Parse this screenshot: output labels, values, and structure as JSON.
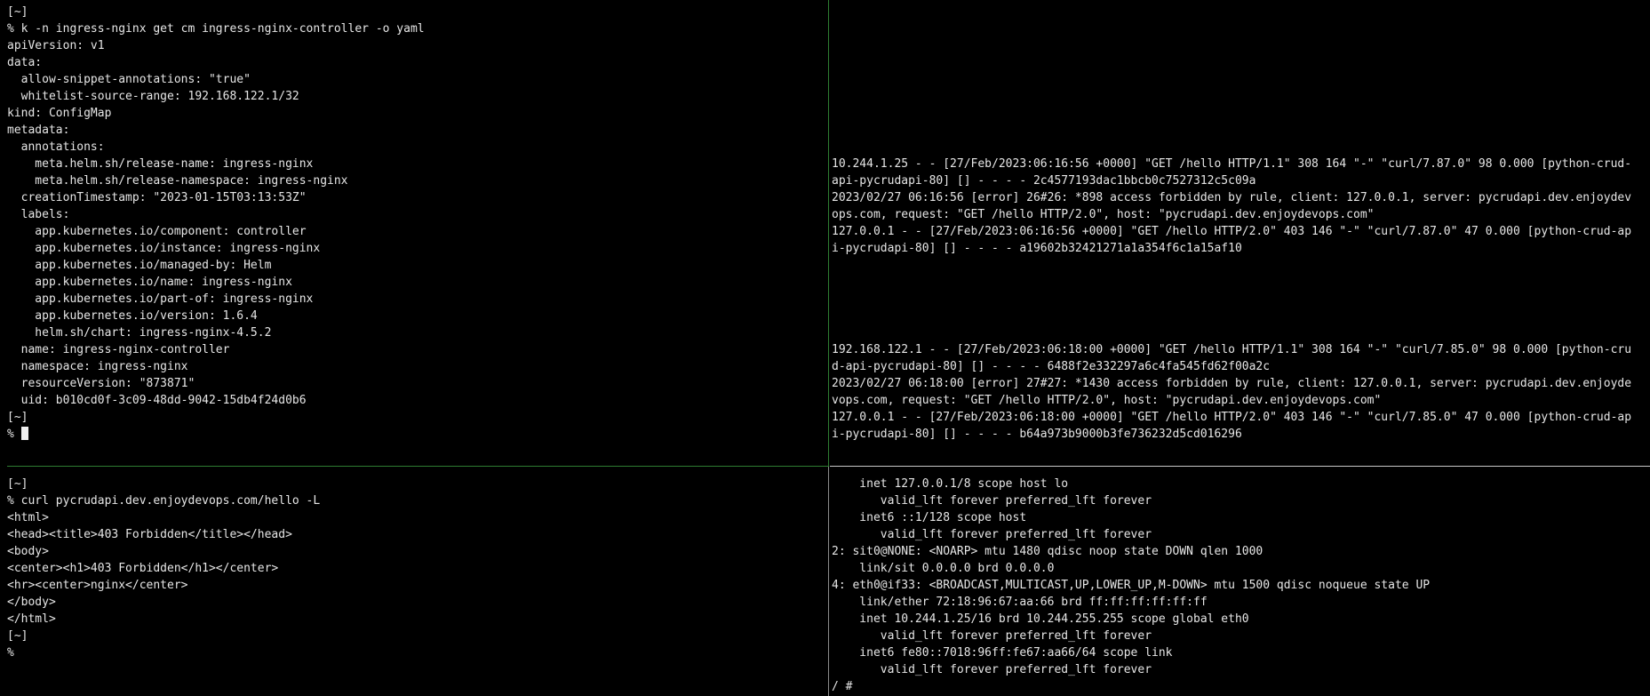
{
  "top_left": {
    "lines": [
      "[~]",
      "% k -n ingress-nginx get cm ingress-nginx-controller -o yaml",
      "apiVersion: v1",
      "data:",
      "  allow-snippet-annotations: \"true\"",
      "  whitelist-source-range: 192.168.122.1/32",
      "kind: ConfigMap",
      "metadata:",
      "  annotations:",
      "    meta.helm.sh/release-name: ingress-nginx",
      "    meta.helm.sh/release-namespace: ingress-nginx",
      "  creationTimestamp: \"2023-01-15T03:13:53Z\"",
      "  labels:",
      "    app.kubernetes.io/component: controller",
      "    app.kubernetes.io/instance: ingress-nginx",
      "    app.kubernetes.io/managed-by: Helm",
      "    app.kubernetes.io/name: ingress-nginx",
      "    app.kubernetes.io/part-of: ingress-nginx",
      "    app.kubernetes.io/version: 1.6.4",
      "    helm.sh/chart: ingress-nginx-4.5.2",
      "  name: ingress-nginx-controller",
      "  namespace: ingress-nginx",
      "  resourceVersion: \"873871\"",
      "  uid: b010cd0f-3c09-48dd-9042-15db4f24d0b6",
      "[~]"
    ],
    "prompt": "% "
  },
  "top_right": {
    "blank_top": "\n\n\n\n\n\n\n\n\n",
    "block1": "10.244.1.25 - - [27/Feb/2023:06:16:56 +0000] \"GET /hello HTTP/1.1\" 308 164 \"-\" \"curl/7.87.0\" 98 0.000 [python-crud-\napi-pycrudapi-80] [] - - - - 2c4577193dac1bbcb0c7527312c5c09a\n2023/02/27 06:16:56 [error] 26#26: *898 access forbidden by rule, client: 127.0.0.1, server: pycrudapi.dev.enjoydev\nops.com, request: \"GET /hello HTTP/2.0\", host: \"pycrudapi.dev.enjoydevops.com\"\n127.0.0.1 - - [27/Feb/2023:06:16:56 +0000] \"GET /hello HTTP/2.0\" 403 146 \"-\" \"curl/7.87.0\" 47 0.000 [python-crud-ap\ni-pycrudapi-80] [] - - - - a19602b32421271a1a354f6c1a15af10",
    "gap": "\n\n\n\n\n",
    "block2": "192.168.122.1 - - [27/Feb/2023:06:18:00 +0000] \"GET /hello HTTP/1.1\" 308 164 \"-\" \"curl/7.85.0\" 98 0.000 [python-cru\nd-api-pycrudapi-80] [] - - - - 6488f2e332297a6c4fa545fd62f00a2c\n2023/02/27 06:18:00 [error] 27#27: *1430 access forbidden by rule, client: 127.0.0.1, server: pycrudapi.dev.enjoyde\nvops.com, request: \"GET /hello HTTP/2.0\", host: \"pycrudapi.dev.enjoydevops.com\"\n127.0.0.1 - - [27/Feb/2023:06:18:00 +0000] \"GET /hello HTTP/2.0\" 403 146 \"-\" \"curl/7.85.0\" 47 0.000 [python-crud-ap\ni-pycrudapi-80] [] - - - - b64a973b9000b3fe736232d5cd016296"
  },
  "bottom_left": {
    "text": "[~]\n% curl pycrudapi.dev.enjoydevops.com/hello -L\n<html>\n<head><title>403 Forbidden</title></head>\n<body>\n<center><h1>403 Forbidden</h1></center>\n<hr><center>nginx</center>\n</body>\n</html>\n[~]\n%"
  },
  "bottom_right": {
    "text": "    inet 127.0.0.1/8 scope host lo\n       valid_lft forever preferred_lft forever\n    inet6 ::1/128 scope host\n       valid_lft forever preferred_lft forever\n2: sit0@NONE: <NOARP> mtu 1480 qdisc noop state DOWN qlen 1000\n    link/sit 0.0.0.0 brd 0.0.0.0\n4: eth0@if33: <BROADCAST,MULTICAST,UP,LOWER_UP,M-DOWN> mtu 1500 qdisc noqueue state UP\n    link/ether 72:18:96:67:aa:66 brd ff:ff:ff:ff:ff:ff\n    inet 10.244.1.25/16 brd 10.244.255.255 scope global eth0\n       valid_lft forever preferred_lft forever\n    inet6 fe80::7018:96ff:fe67:aa66/64 scope link\n       valid_lft forever preferred_lft forever\n/ #"
  }
}
